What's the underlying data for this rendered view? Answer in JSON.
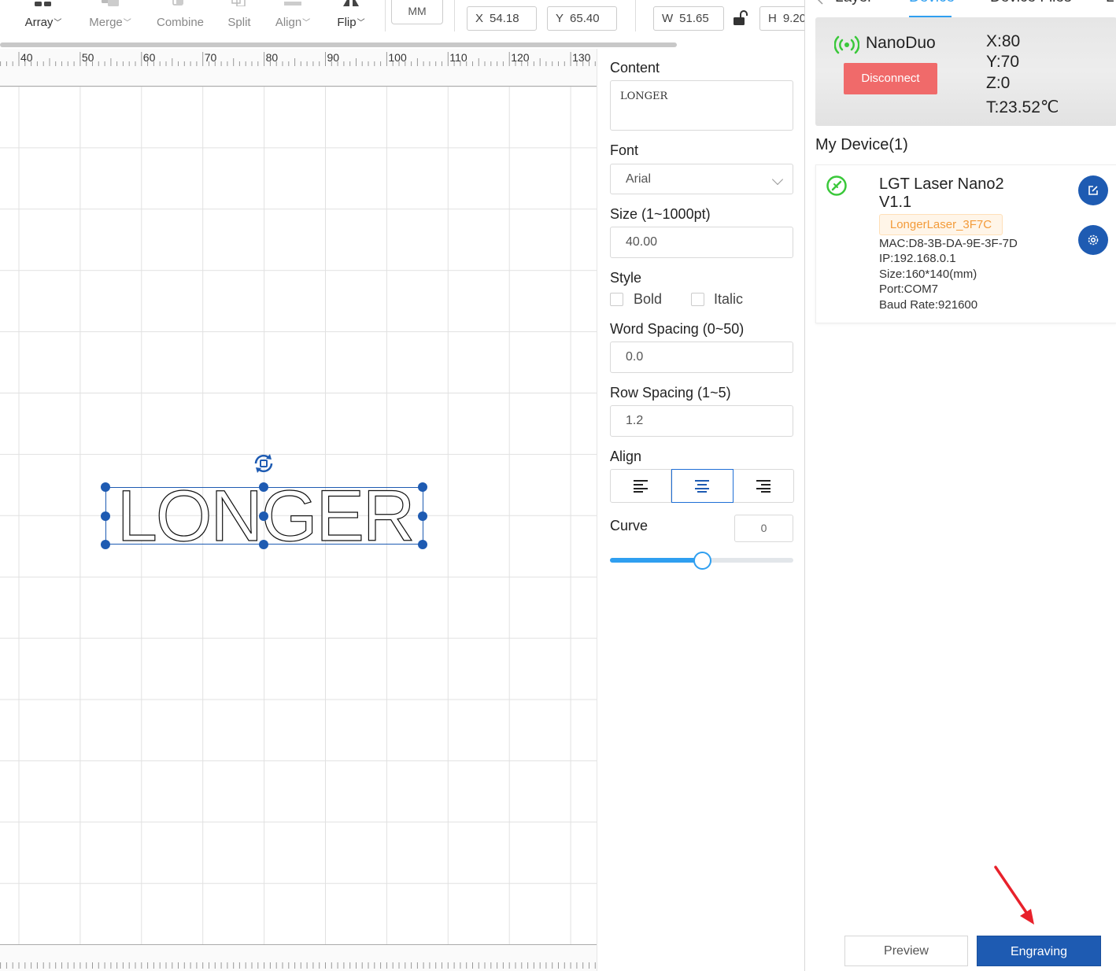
{
  "toolbar": {
    "array_label": "Array",
    "merge_label": "Merge",
    "combine_label": "Combine",
    "split_label": "Split",
    "align_label": "Align",
    "flip_label": "Flip",
    "unit_label": "MM",
    "x_key": "X",
    "x_value": "54.18",
    "y_key": "Y",
    "y_value": "65.40",
    "w_key": "W",
    "w_value": "51.65",
    "h_key": "H",
    "h_value": "9.20",
    "chevron": "﹀"
  },
  "ruler": {
    "top_ticks": [
      "40",
      "50",
      "60",
      "70",
      "80",
      "90",
      "100",
      "110",
      "120",
      "130"
    ]
  },
  "canvas": {
    "text_object": "LONGER"
  },
  "props": {
    "content_label": "Content",
    "content_value": "LONGER",
    "font_label": "Font",
    "font_value": "Arial",
    "size_label": "Size (1~1000pt)",
    "size_value": "40.00",
    "style_label": "Style",
    "bold_label": "Bold",
    "italic_label": "Italic",
    "word_spacing_label": "Word Spacing (0~50)",
    "word_spacing_value": "0.0",
    "row_spacing_label": "Row Spacing (1~5)",
    "row_spacing_value": "1.2",
    "align_label": "Align",
    "align_active": "center",
    "curve_label": "Curve",
    "curve_value": "0",
    "curve_slider_fraction": 0.5
  },
  "right_panel": {
    "tabs": [
      "Layer",
      "Device",
      "Device Files",
      "L"
    ],
    "active_tab": "Device",
    "status": {
      "device_name": "NanoDuo",
      "disconnect_label": "Disconnect",
      "x": "X:80",
      "y": "Y:70",
      "z": "Z:0",
      "t": "T:23.52℃"
    },
    "my_device_title": "My Device(1)",
    "device": {
      "model": "LGT Laser Nano2 V1.1",
      "tag": "LongerLaser_3F7C",
      "mac": "MAC:D8-3B-DA-9E-3F-7D",
      "ip": "IP:192.168.0.1",
      "size": "Size:160*140(mm)",
      "port": "Port:COM7",
      "baud": "Baud Rate:921600"
    },
    "preview_label": "Preview",
    "engraving_label": "Engraving"
  },
  "colors": {
    "accent": "#2f9ff0",
    "primary_button": "#1e5bb2",
    "disconnect": "#f06a6a",
    "connected_icon": "#3ac83a",
    "annotation_arrow": "#e8212b"
  }
}
